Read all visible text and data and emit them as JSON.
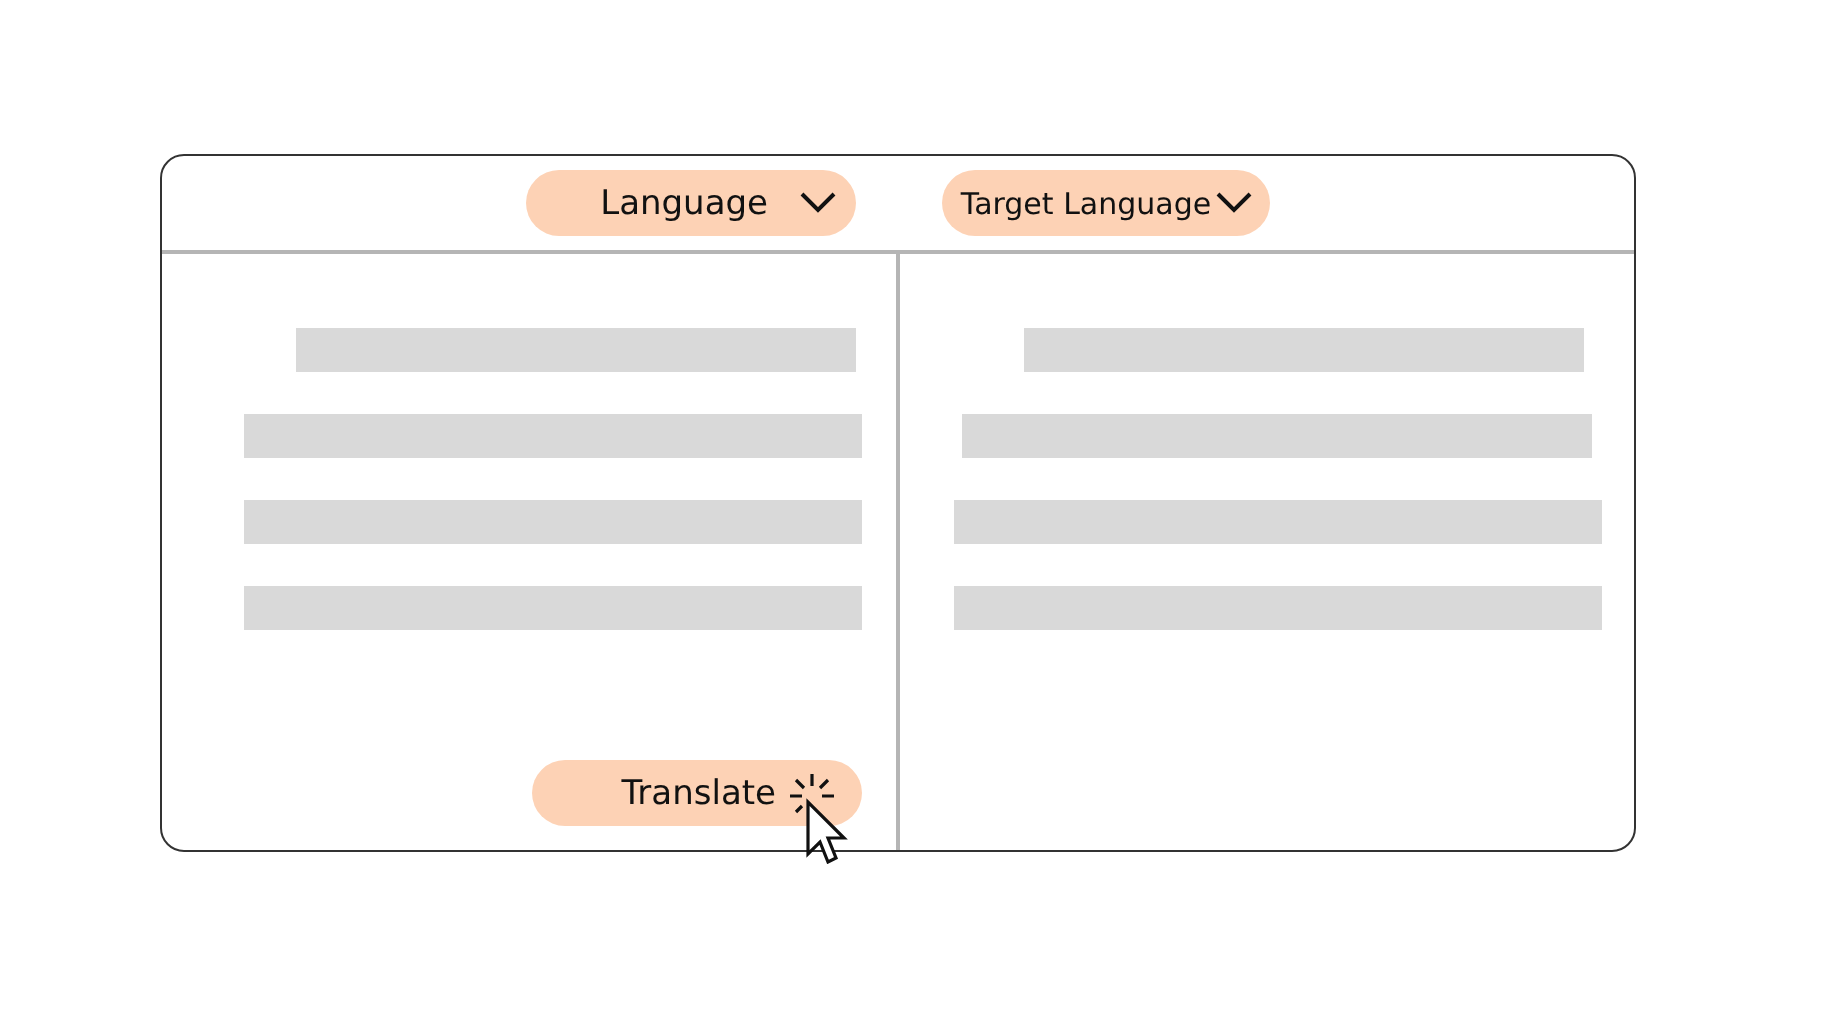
{
  "header": {
    "source_language": {
      "label": "Language"
    },
    "target_language": {
      "label": "Target Language"
    }
  },
  "actions": {
    "translate": {
      "label": "Translate"
    }
  }
}
